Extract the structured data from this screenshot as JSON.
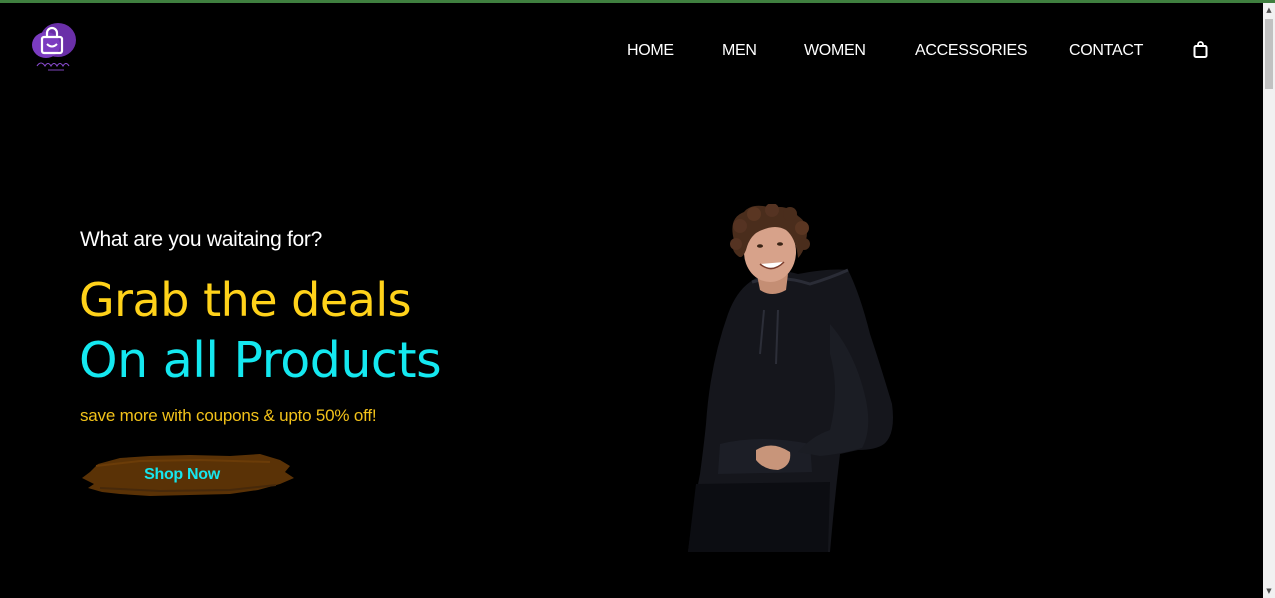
{
  "brand": {
    "logo_icon": "shopping-bag-logo",
    "accent_color": "#6a2fa8"
  },
  "nav": {
    "items": [
      {
        "label": "HOME"
      },
      {
        "label": "MEN"
      },
      {
        "label": "WOMEN"
      },
      {
        "label": "ACCESSORIES"
      },
      {
        "label": "CONTACT"
      }
    ],
    "cart_icon": "shopping-bag-icon"
  },
  "hero": {
    "eyebrow": "What are you waitaing for?",
    "headline_line1": "Grab the deals",
    "headline_line2": "On all Products",
    "subtext": "save more with coupons & upto 50% off!",
    "cta_label": "Shop Now",
    "image": "smiling-man-black-hoodie"
  },
  "colors": {
    "background": "#000000",
    "headline_yellow": "#ffd21a",
    "headline_cyan": "#14e8f0",
    "subtext_gold": "#f2c21a",
    "cta_brush": "#5a3206",
    "cta_text": "#16e6ee"
  }
}
